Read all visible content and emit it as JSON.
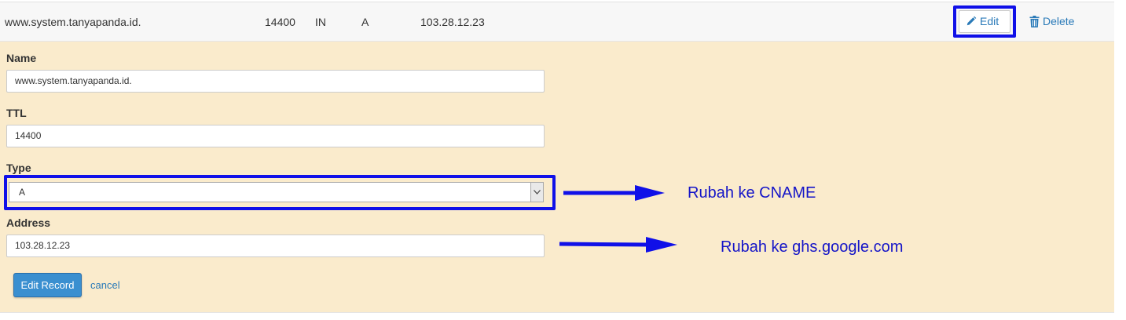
{
  "record_row": {
    "name": "www.system.tanyapanda.id.",
    "ttl": "14400",
    "class": "IN",
    "type": "A",
    "record": "103.28.12.23",
    "edit_label": "Edit",
    "delete_label": "Delete"
  },
  "form": {
    "name_label": "Name",
    "name_value": "www.system.tanyapanda.id.",
    "ttl_label": "TTL",
    "ttl_value": "14400",
    "type_label": "Type",
    "type_value": "A",
    "address_label": "Address",
    "address_value": "103.28.12.23",
    "submit_label": "Edit Record",
    "cancel_label": "cancel"
  },
  "annotations": {
    "type_note": "Rubah ke CNAME",
    "address_note": "Rubah ke ghs.google.com"
  },
  "colors": {
    "highlight": "#1010e8",
    "panel_background": "#faebcc",
    "link": "#2a7ab8",
    "primary_button": "#3a8fd0",
    "annotation_text": "#1515c8"
  },
  "icons": {
    "edit": "pencil-icon",
    "delete": "trash-icon",
    "select": "chevron-down-icon"
  }
}
